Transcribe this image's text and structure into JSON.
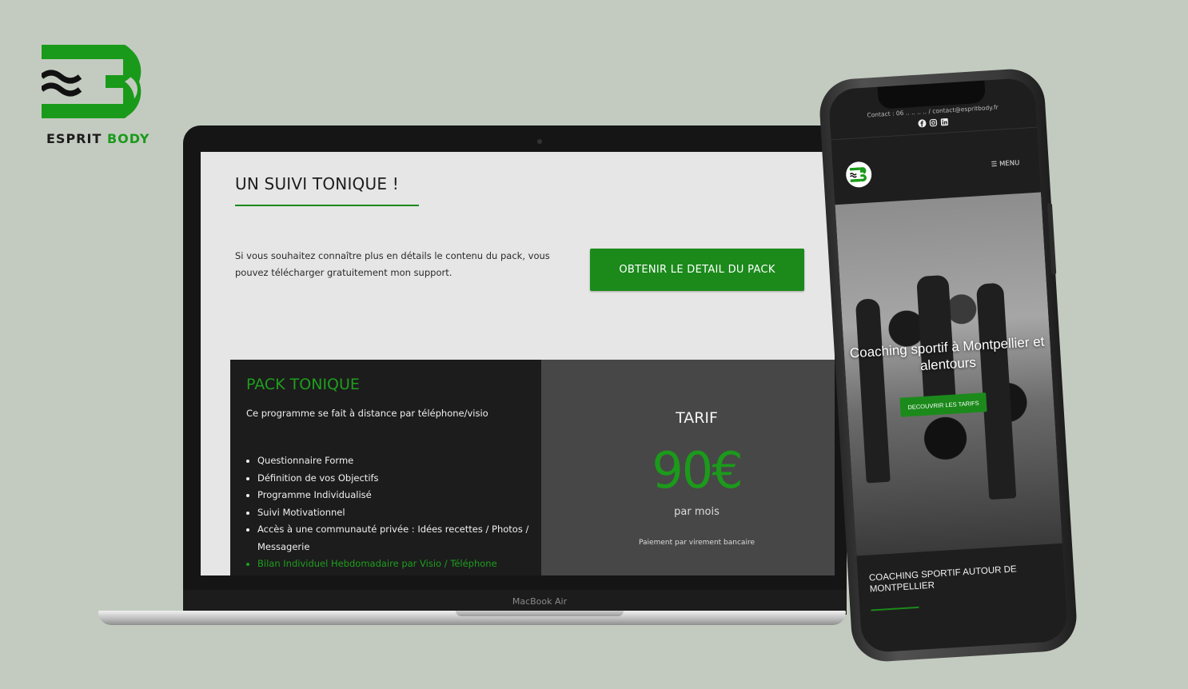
{
  "brand": {
    "name_part1": "ESPRIT",
    "name_part2": "BODY",
    "colors": {
      "green": "#1a9a1a",
      "dark": "#1c1c1c",
      "background": "#c3cbc0"
    }
  },
  "laptop": {
    "model_label": "MacBook Air",
    "section_title": "UN SUIVI TONIQUE !",
    "intro_text": "Si vous souhaitez connaître plus en détails le contenu du pack, vous pouvez télécharger gratuitement mon support.",
    "cta_label": "OBTENIR LE DETAIL DU PACK",
    "pack": {
      "title": "PACK TONIQUE",
      "subtitle": "Ce programme se fait à distance par téléphone/visio",
      "features": [
        "Questionnaire Forme",
        "Définition de vos Objectifs",
        "Programme Individualisé",
        "Suivi Motivationnel",
        "Accès à une communauté privée : Idées recettes / Photos / Messagerie",
        "Bilan Individuel Hebdomadaire par Visio / Téléphone"
      ]
    },
    "tarif": {
      "label": "TARIF",
      "price": "90€",
      "period": "par mois",
      "payment_note": "Paiement par virement bancaire"
    }
  },
  "phone": {
    "contact_line": "Contact : 06 .. .. .. .. / contact@espritbody.fr",
    "social_icons": [
      "facebook-icon",
      "instagram-icon",
      "linkedin-icon"
    ],
    "menu_label": "MENU",
    "hero_title": "Coaching sportif à Montpellier et alentours",
    "hero_button": "DECOUVRIR LES TARIFS",
    "section_title": "COACHING SPORTIF AUTOUR DE MONTPELLIER"
  }
}
